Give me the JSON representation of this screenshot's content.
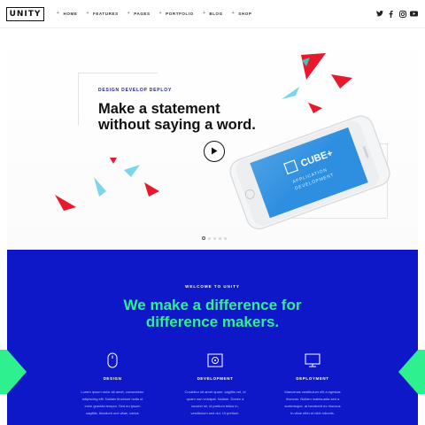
{
  "header": {
    "logo": "UNITY",
    "nav": [
      {
        "label": "HOME"
      },
      {
        "label": "FEATURES"
      },
      {
        "label": "PAGES"
      },
      {
        "label": "PORTFOLIO"
      },
      {
        "label": "BLOG"
      },
      {
        "label": "SHOP"
      }
    ],
    "social": [
      "twitter-icon",
      "facebook-icon",
      "instagram-icon",
      "youtube-icon"
    ]
  },
  "hero": {
    "eyebrow": "DESIGN DEVELOP DEPLOY",
    "title_line1": "Make a statement",
    "title_line2": "without saying a word.",
    "phone_screen": {
      "brand": "CUBE+",
      "line1": "APPLICATION",
      "line2": "DEVELOPMENT"
    },
    "slides": {
      "total": 5,
      "active": 1
    }
  },
  "about": {
    "welcome": "WELCOME TO UNITY",
    "title_line1": "We make a difference for",
    "title_line2": "difference makers.",
    "features": [
      {
        "icon": "mouse-icon",
        "title": "DESIGN",
        "text": [
          "Lorem ipsum dolor sit amet, consectetur",
          "adipiscing elit. Nullam tincidunt nulla ut",
          "enim gravida tempor. Sed eu ipsum",
          "sagittis, tincidunt orci vitae, varius"
        ]
      },
      {
        "icon": "monitor-code-icon",
        "title": "DEVELOPMENT",
        "text": [
          "Curabitur sit amet quam, sagittis vel, id",
          "quam non volutpat. Nullam. Donec a",
          "laoreet mi, id pretium tellus in,",
          "vestibulum sed dui. Ut pretium."
        ]
      },
      {
        "icon": "display-icon",
        "title": "DEPLOYMENT",
        "text": [
          "Maecenas vestibulum elit a egestas",
          "rhoncus. Nullam malesuada sed a",
          "scelerisque, at hendrerit ex rhoncus",
          "In vitae nibh et nibh lobortis."
        ]
      }
    ]
  },
  "colors": {
    "brand_blue": "#0e18c8",
    "accent_green": "#2ef08e",
    "accent_red": "#e8192c",
    "accent_cyan": "#7ad6e8"
  }
}
